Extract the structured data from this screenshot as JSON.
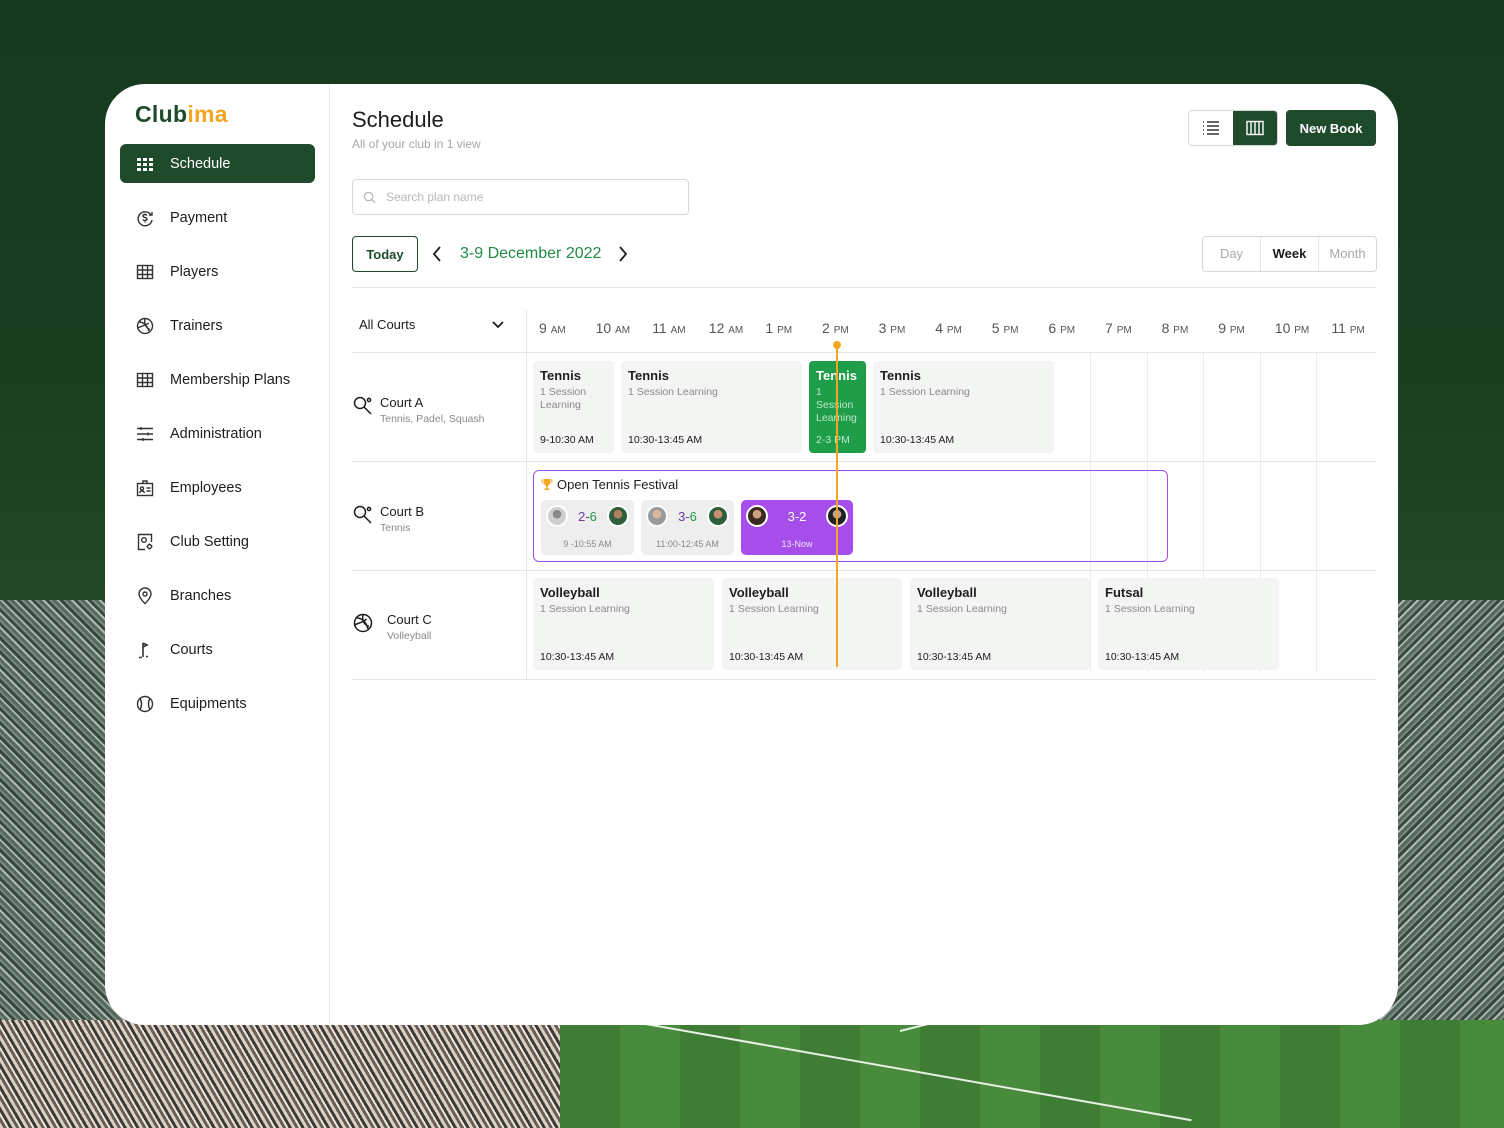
{
  "brand": {
    "name_main": "Club",
    "name_accent": "ima",
    "accent_color": "#f3a623",
    "primary_color": "#1f4a2b"
  },
  "sidebar": {
    "items": [
      {
        "label": "Schedule",
        "icon": "grid-icon",
        "active": true
      },
      {
        "label": "Payment",
        "icon": "payment-icon"
      },
      {
        "label": "Players",
        "icon": "table-icon"
      },
      {
        "label": "Trainers",
        "icon": "ball-icon"
      },
      {
        "label": "Membership Plans",
        "icon": "table-icon"
      },
      {
        "label": "Administration",
        "icon": "sliders-icon"
      },
      {
        "label": "Employees",
        "icon": "id-card-icon"
      },
      {
        "label": "Club Setting",
        "icon": "settings-doc-icon"
      },
      {
        "label": "Branches",
        "icon": "location-pin-icon"
      },
      {
        "label": "Courts",
        "icon": "flag-icon"
      },
      {
        "label": "Equipments",
        "icon": "tennis-ball-icon"
      }
    ]
  },
  "header": {
    "title": "Schedule",
    "subtitle": "All of your club in 1 view",
    "new_book_label": "New Book"
  },
  "search": {
    "placeholder": "Search plan name",
    "value": ""
  },
  "toolbar": {
    "today_label": "Today",
    "date_range": "3-9 December 2022",
    "range_options": [
      "Day",
      "Week",
      "Month"
    ],
    "range_selected": "Week"
  },
  "grid": {
    "court_filter": "All Courts",
    "hours": [
      {
        "num": "9",
        "ampm": "AM"
      },
      {
        "num": "10",
        "ampm": "AM"
      },
      {
        "num": "11",
        "ampm": "AM"
      },
      {
        "num": "12",
        "ampm": "AM"
      },
      {
        "num": "1",
        "ampm": "PM"
      },
      {
        "num": "2",
        "ampm": "PM"
      },
      {
        "num": "3",
        "ampm": "PM"
      },
      {
        "num": "4",
        "ampm": "PM"
      },
      {
        "num": "5",
        "ampm": "PM"
      },
      {
        "num": "6",
        "ampm": "PM"
      },
      {
        "num": "7",
        "ampm": "PM"
      },
      {
        "num": "8",
        "ampm": "PM"
      },
      {
        "num": "9",
        "ampm": "PM"
      },
      {
        "num": "10",
        "ampm": "PM"
      },
      {
        "num": "11",
        "ampm": "PM"
      }
    ],
    "courts": [
      {
        "name": "Court A",
        "sports": "Tennis, Padel, Squash",
        "icon": "racket-icon"
      },
      {
        "name": "Court B",
        "sports": "Tennis",
        "icon": "racket-icon"
      },
      {
        "name": "Court C",
        "sports": "Volleyball",
        "icon": "volleyball-icon"
      }
    ],
    "court_a_events": [
      {
        "title": "Tennis",
        "sub": "1 Session Learning",
        "time": "9-10:30 AM"
      },
      {
        "title": "Tennis",
        "sub": "1 Session Learning",
        "time": "10:30-13:45 AM"
      },
      {
        "title": "Tennis",
        "sub": "1 Session Learning",
        "time": "2-3 PM",
        "live": true
      },
      {
        "title": "Tennis",
        "sub": "1 Session Learning",
        "time": "10:30-13:45 AM"
      }
    ],
    "festival": {
      "title": "Open Tennis Festival",
      "icon": "trophy-icon",
      "matches": [
        {
          "score_a": "2",
          "score_b": "6",
          "time": "9 -10:55 AM"
        },
        {
          "score_a": "3",
          "score_b": "6",
          "time": "11:00-12:45 AM"
        },
        {
          "score_a": "3",
          "score_b": "2",
          "time": "13-Now",
          "live": true
        }
      ]
    },
    "court_c_events": [
      {
        "title": "Volleyball",
        "sub": "1 Session Learning",
        "time": "10:30-13:45 AM"
      },
      {
        "title": "Volleyball",
        "sub": "1 Session Learning",
        "time": "10:30-13:45 AM"
      },
      {
        "title": "Volleyball",
        "sub": "1 Session Learning",
        "time": "10:30-13:45 AM"
      },
      {
        "title": "Futsal",
        "sub": "1 Session Learning",
        "time": "10:30-13:45 AM"
      }
    ]
  }
}
